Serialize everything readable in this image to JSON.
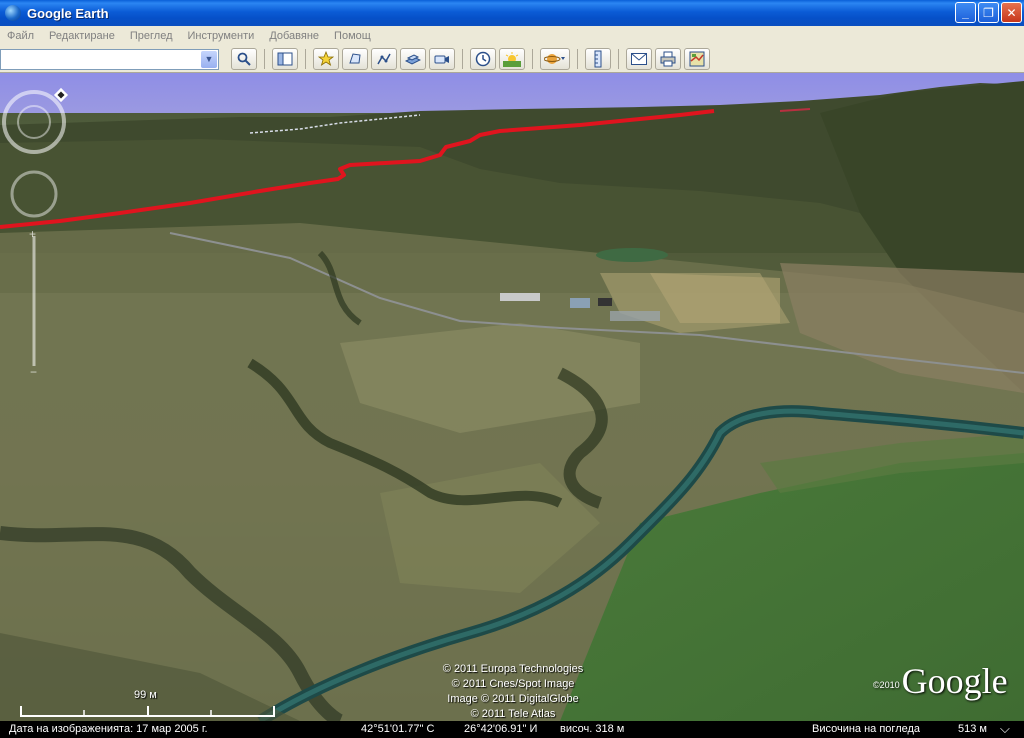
{
  "window": {
    "title": "Google Earth",
    "minimize_label": "_",
    "maximize_label": "❐",
    "close_label": "✕"
  },
  "menu": {
    "items": [
      "Файл",
      "Редактиране",
      "Преглед",
      "Инструменти",
      "Добавяне",
      "Помощ"
    ]
  },
  "search": {
    "value": "",
    "placeholder": ""
  },
  "toolbar": {
    "icons": [
      "sidebar-toggle-icon",
      "placemark-icon",
      "polygon-icon",
      "path-icon",
      "image-overlay-icon",
      "record-tour-icon",
      "historical-imagery-icon",
      "sunlight-icon",
      "planets-icon",
      "ruler-icon",
      "email-icon",
      "print-icon",
      "view-in-maps-icon"
    ]
  },
  "attribution": {
    "line1": "© 2011 Europa Technologies",
    "line2": "© 2011 Cnes/Spot Image",
    "line3": "Image © 2011 DigitalGlobe",
    "line4": "© 2011 Tele Atlas"
  },
  "logo": {
    "year": "©2010",
    "text": "Google"
  },
  "scale": {
    "label": "99 м"
  },
  "status": {
    "imagery_date": "Дата на изображенията: 17 мар 2005 г.",
    "latitude": "42°51'01.77\" С",
    "longitude": "26°42'06.91\" И",
    "elevation": "височ.  318 м",
    "eye_alt_label": "Височина на погледа",
    "eye_alt_value": "513 м"
  },
  "colors": {
    "sky": "#8c8be0",
    "track": "#e0141e",
    "titlebar": "#0a5fd8"
  }
}
